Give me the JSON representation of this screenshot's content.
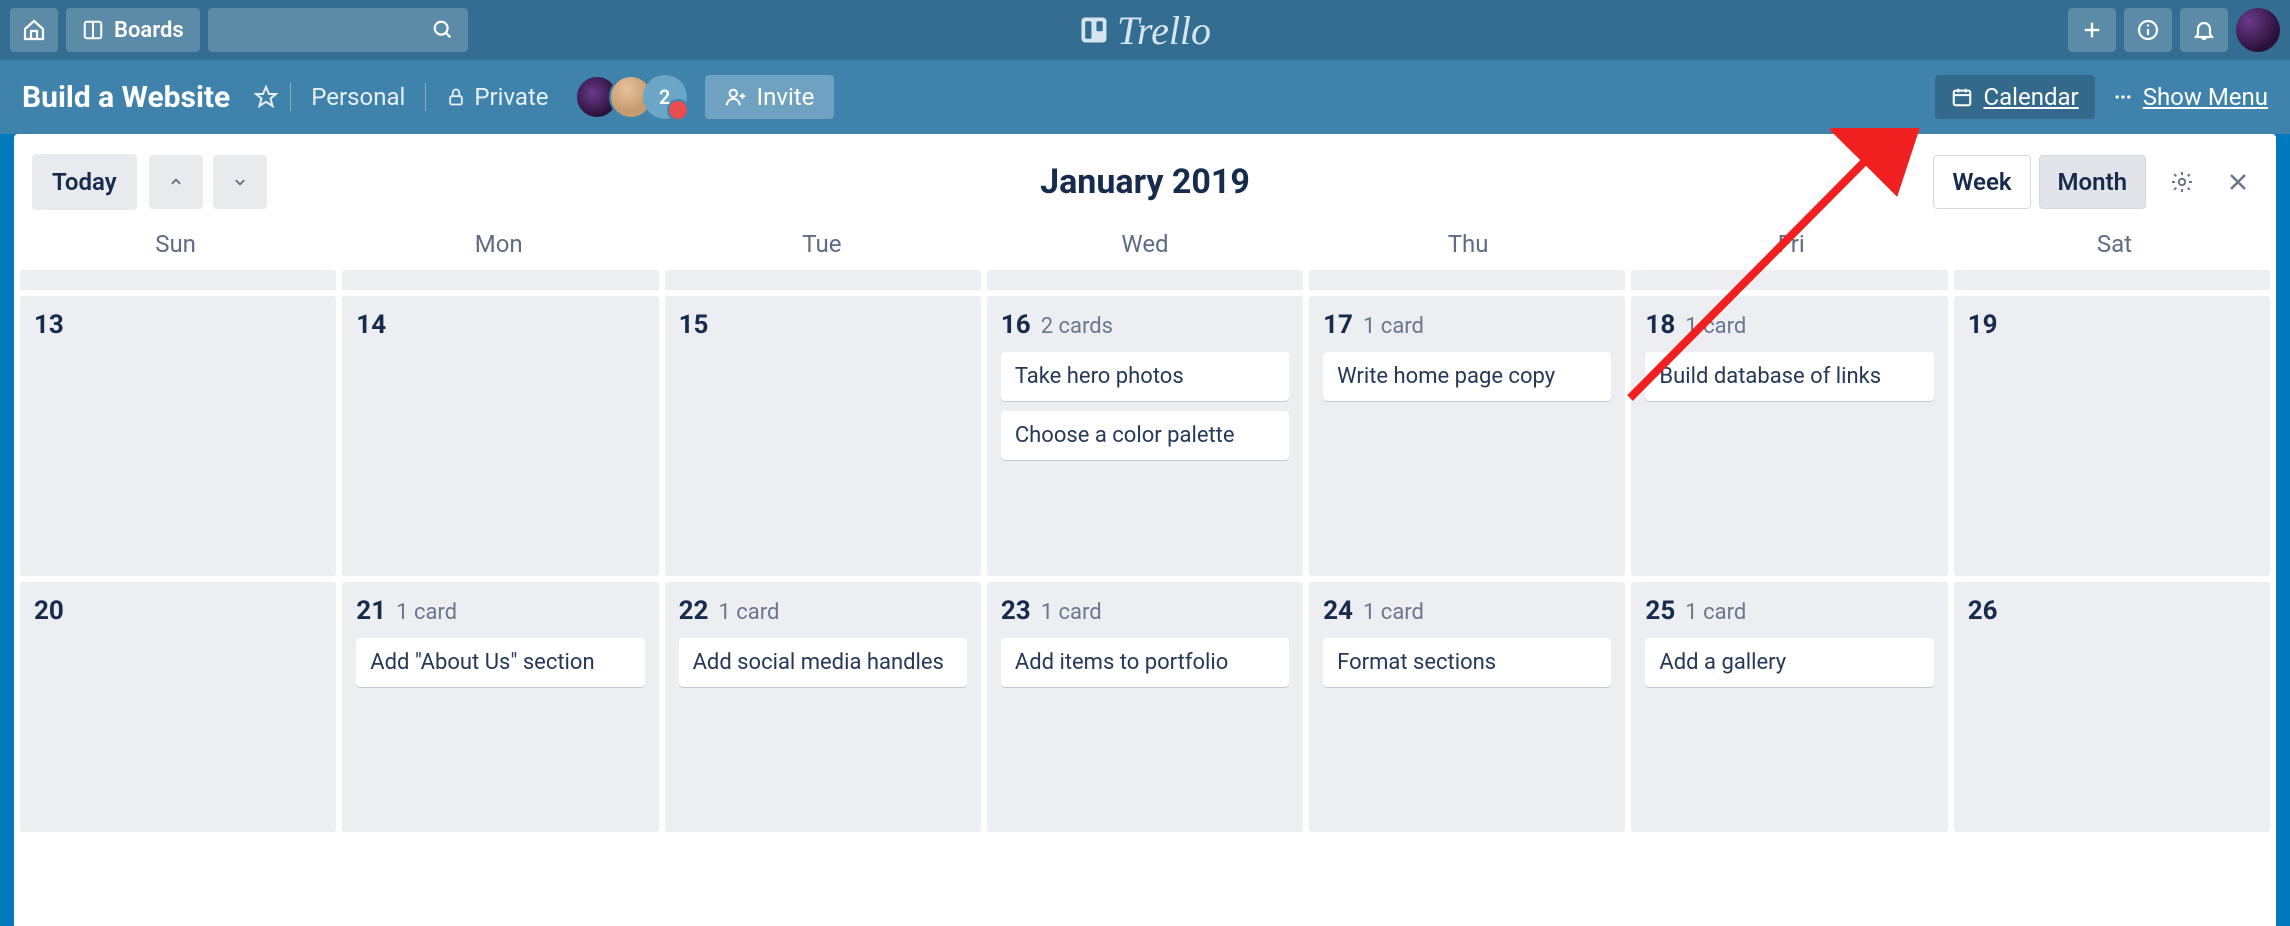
{
  "header": {
    "boards_label": "Boards",
    "logo_text": "Trello"
  },
  "board": {
    "title": "Build a Website",
    "team_label": "Personal",
    "visibility_label": "Private",
    "member_count": "2",
    "invite_label": "Invite",
    "calendar_label": "Calendar",
    "show_menu_label": "Show Menu"
  },
  "calendar": {
    "today_label": "Today",
    "title": "January 2019",
    "week_label": "Week",
    "month_label": "Month",
    "day_headers": [
      "Sun",
      "Mon",
      "Tue",
      "Wed",
      "Thu",
      "Fri",
      "Sat"
    ],
    "rows": [
      [
        {
          "day": "13",
          "count": "",
          "cards": []
        },
        {
          "day": "14",
          "count": "",
          "cards": []
        },
        {
          "day": "15",
          "count": "",
          "cards": []
        },
        {
          "day": "16",
          "count": "2 cards",
          "cards": [
            "Take hero photos",
            "Choose a color palette"
          ]
        },
        {
          "day": "17",
          "count": "1 card",
          "cards": [
            "Write home page copy"
          ]
        },
        {
          "day": "18",
          "count": "1 card",
          "cards": [
            "Build database of links"
          ]
        },
        {
          "day": "19",
          "count": "",
          "cards": []
        }
      ],
      [
        {
          "day": "20",
          "count": "",
          "cards": []
        },
        {
          "day": "21",
          "count": "1 card",
          "cards": [
            "Add \"About Us\" section"
          ]
        },
        {
          "day": "22",
          "count": "1 card",
          "cards": [
            "Add social media handles"
          ]
        },
        {
          "day": "23",
          "count": "1 card",
          "cards": [
            "Add items to portfolio"
          ]
        },
        {
          "day": "24",
          "count": "1 card",
          "cards": [
            "Format sections"
          ]
        },
        {
          "day": "25",
          "count": "1 card",
          "cards": [
            "Add a gallery"
          ]
        },
        {
          "day": "26",
          "count": "",
          "cards": []
        }
      ]
    ]
  }
}
